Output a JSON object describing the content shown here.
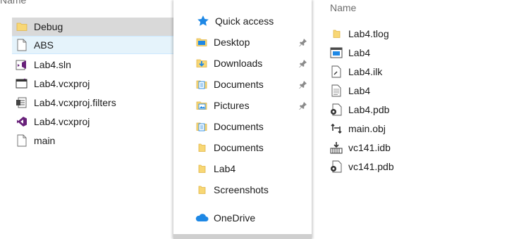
{
  "left": {
    "header": "Name",
    "items": [
      {
        "label": "Debug",
        "icon": "folder-icon",
        "state": "selected"
      },
      {
        "label": "ABS",
        "icon": "blank-file-icon",
        "state": "hover"
      },
      {
        "label": "Lab4.sln",
        "icon": "visual-studio-solution-icon"
      },
      {
        "label": "Lab4.vcxproj",
        "icon": "project-window-icon"
      },
      {
        "label": "Lab4.vcxproj.filters",
        "icon": "filters-file-icon"
      },
      {
        "label": "Lab4.vcxproj",
        "icon": "visual-studio-project-icon"
      },
      {
        "label": "main",
        "icon": "blank-file-icon"
      }
    ]
  },
  "nav": {
    "quick_access": "Quick access",
    "items": [
      {
        "label": "Desktop",
        "icon": "desktop-folder-icon",
        "pinned": true
      },
      {
        "label": "Downloads",
        "icon": "downloads-folder-icon",
        "pinned": true
      },
      {
        "label": "Documents",
        "icon": "documents-folder-icon",
        "pinned": true
      },
      {
        "label": "Pictures",
        "icon": "pictures-folder-icon",
        "pinned": true
      },
      {
        "label": "Documents",
        "icon": "documents-folder-icon",
        "pinned": false
      },
      {
        "label": "Documents",
        "icon": "folder-icon",
        "pinned": false
      },
      {
        "label": "Lab4",
        "icon": "folder-icon",
        "pinned": false
      },
      {
        "label": "Screenshots",
        "icon": "folder-icon",
        "pinned": false
      }
    ],
    "onedrive": "OneDrive"
  },
  "right": {
    "header": "Name",
    "items": [
      {
        "label": "Lab4.tlog",
        "icon": "folder-icon"
      },
      {
        "label": "Lab4",
        "icon": "application-icon"
      },
      {
        "label": "Lab4.ilk",
        "icon": "ilk-file-icon"
      },
      {
        "label": "Lab4",
        "icon": "text-file-icon"
      },
      {
        "label": "Lab4.pdb",
        "icon": "pdb-file-icon"
      },
      {
        "label": "main.obj",
        "icon": "obj-file-icon"
      },
      {
        "label": "vc141.idb",
        "icon": "idb-file-icon"
      },
      {
        "label": "vc141.pdb",
        "icon": "pdb-file-icon"
      }
    ]
  },
  "colors": {
    "folder": "#f8d775",
    "folder_dark": "#e0b548",
    "accent_blue": "#1e88e5",
    "vs_purple": "#68217a",
    "selected_bg": "#d9d9d9",
    "hover_bg": "#e5f3fb"
  }
}
